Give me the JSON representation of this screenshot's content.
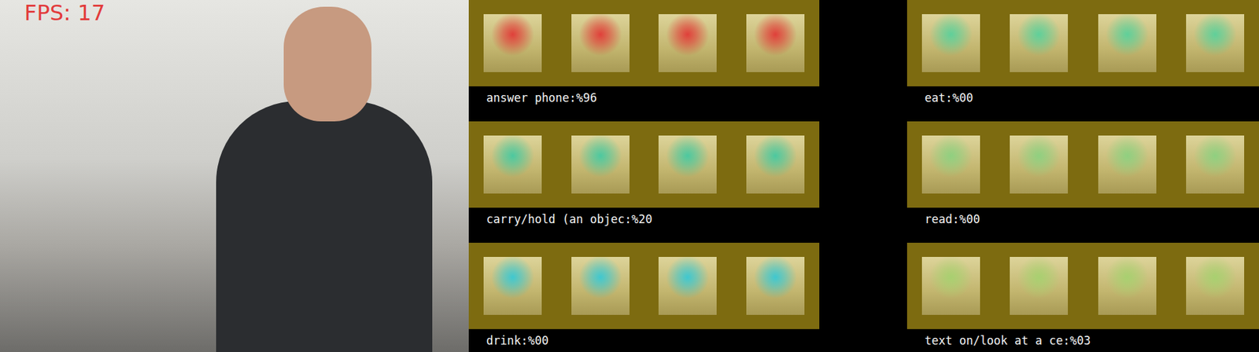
{
  "video": {
    "fps_label": "FPS: 17"
  },
  "columns": [
    [
      {
        "label": "answer phone:%96",
        "color": "#e0403a"
      },
      {
        "label": "carry/hold (an objec:%20",
        "color": "#4cc9a0"
      },
      {
        "label": "drink:%00",
        "color": "#3fc8d0"
      }
    ],
    [
      {
        "label": "eat:%00",
        "color": "#5fd09a"
      },
      {
        "label": "read:%00",
        "color": "#8fd080"
      },
      {
        "label": "text on/look at a ce:%03",
        "color": "#a8d070"
      }
    ]
  ]
}
